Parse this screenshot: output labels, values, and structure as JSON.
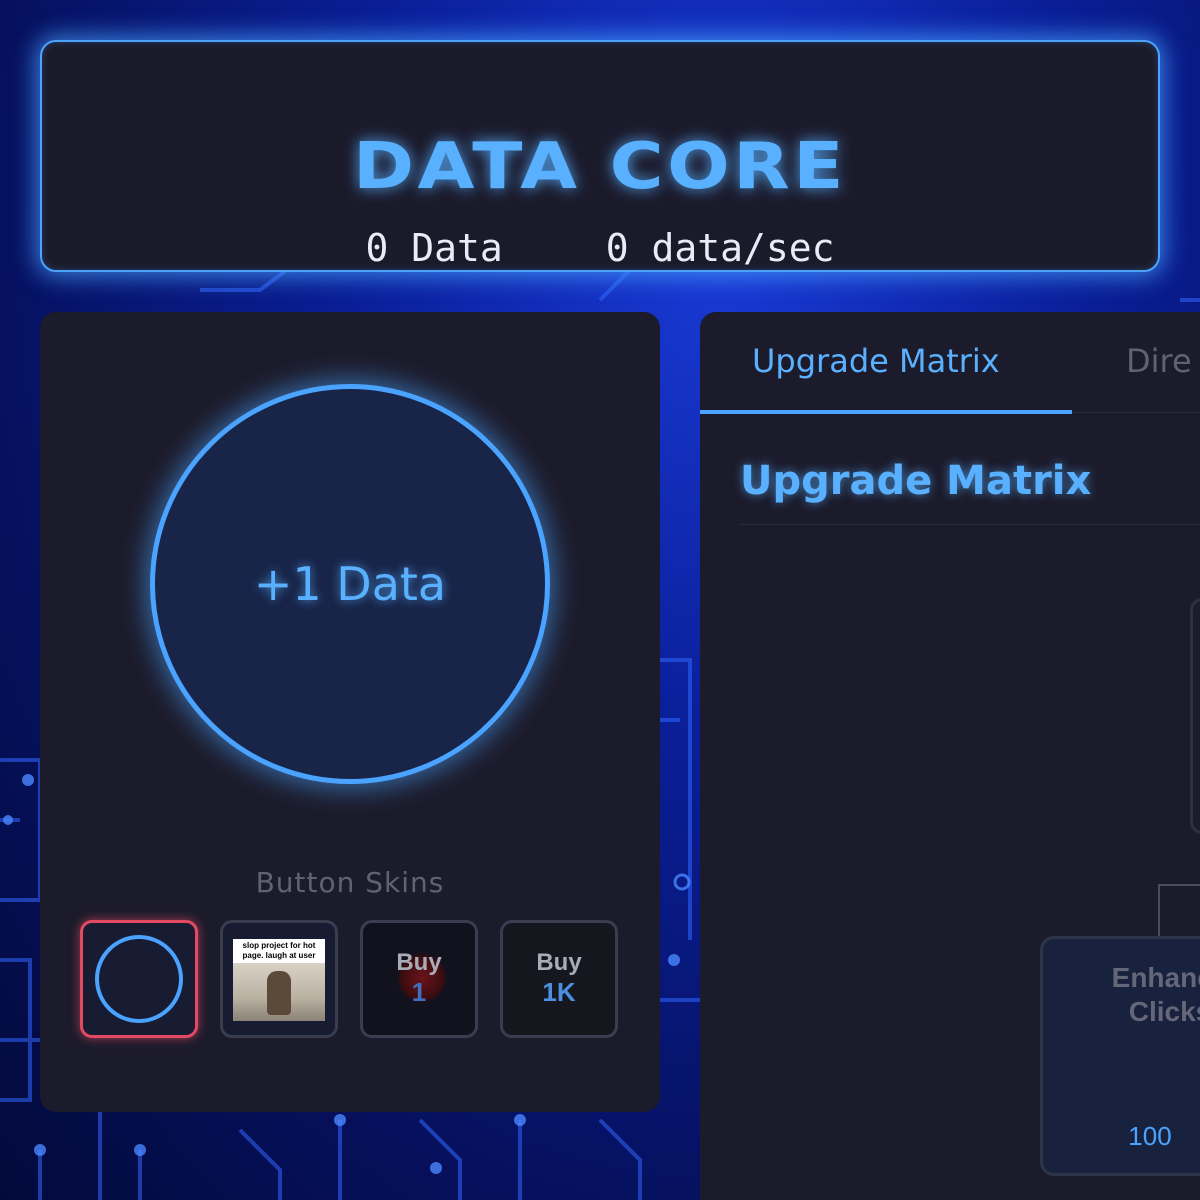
{
  "header": {
    "title": "DATA CORE",
    "data_count": "0 Data",
    "data_rate": "0 data/sec"
  },
  "clicker": {
    "button_label": "+1 Data"
  },
  "skins": {
    "heading": "Button Skins",
    "items": [
      {
        "type": "ring",
        "active": true
      },
      {
        "type": "meme",
        "caption": "slop project for hot page. laugh at user"
      },
      {
        "word": "Buy",
        "amount": "1",
        "amount_color": "#4a7fd0"
      },
      {
        "word": "Buy",
        "amount": "1K",
        "amount_color": "#4a8fe0"
      }
    ]
  },
  "tabs": [
    {
      "label": "Upgrade Matrix",
      "active": true
    },
    {
      "label": "Dire",
      "active": false
    }
  ],
  "upgrades": {
    "section_title": "Upgrade Matrix",
    "node": {
      "title_line1": "Enhance",
      "title_line2": "Clicks",
      "cost": "100"
    }
  },
  "colors": {
    "accent": "#4aa3ff",
    "panel": "#1c1b2b",
    "active_skin_border": "#e24a62"
  }
}
